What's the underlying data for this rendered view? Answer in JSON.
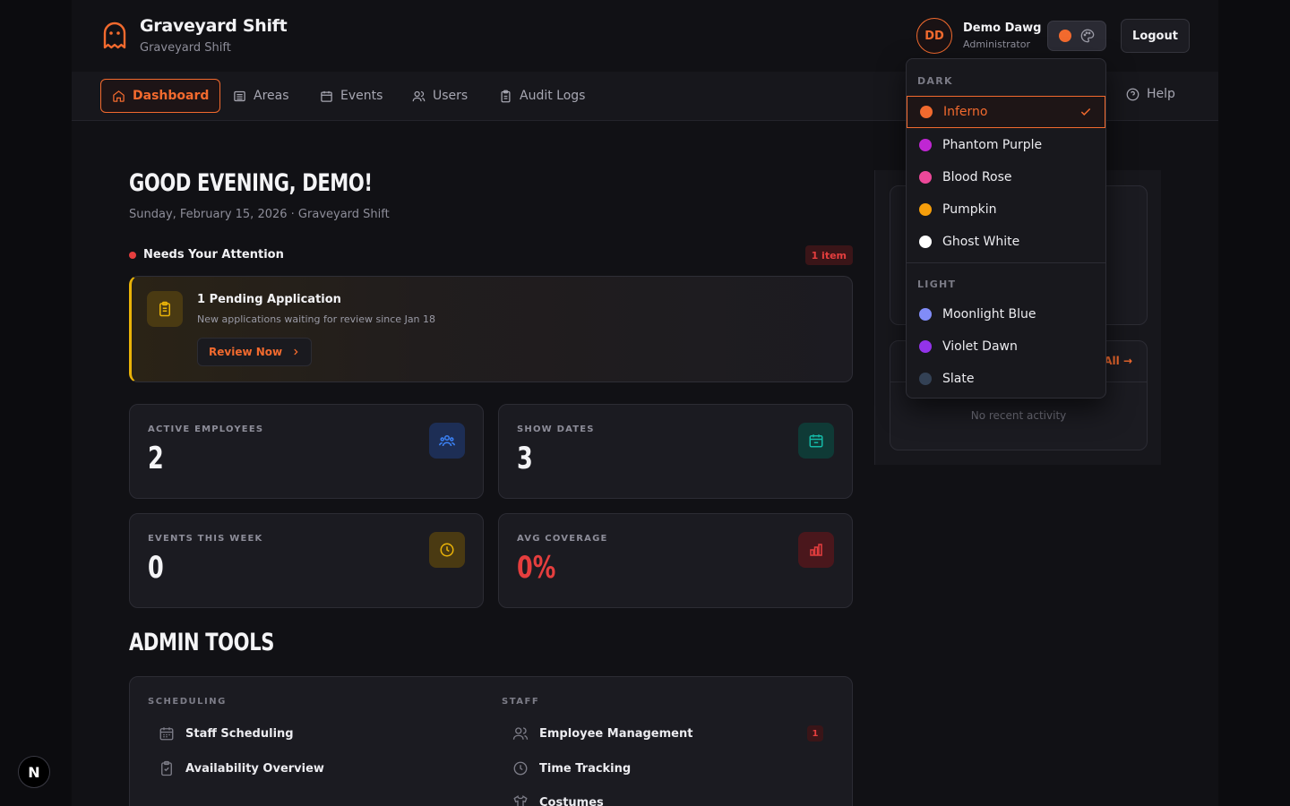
{
  "colors": {
    "accent": "#f26a2e",
    "danger": "#e53e3e",
    "warning": "#eab308"
  },
  "brand": {
    "title": "Graveyard Shift",
    "subtitle": "Graveyard Shift",
    "icon": "ghost-icon"
  },
  "user": {
    "initials": "DD",
    "name": "Demo Dawg",
    "role": "Administrator",
    "logout_label": "Logout"
  },
  "nav": {
    "items": [
      {
        "label": "Dashboard",
        "icon": "home-icon"
      },
      {
        "label": "Areas",
        "icon": "building-icon"
      },
      {
        "label": "Events",
        "icon": "calendar-icon"
      },
      {
        "label": "Users",
        "icon": "users-icon"
      },
      {
        "label": "Audit Logs",
        "icon": "clipboard-icon"
      }
    ],
    "help_label": "Help"
  },
  "greeting": {
    "title": "GOOD EVENING, DEMO!",
    "date_line": "Sunday, February 15, 2026 · Graveyard Shift"
  },
  "attention": {
    "label": "Needs Your Attention",
    "badge": "1 item",
    "card": {
      "title": "1 Pending Application",
      "description": "New applications waiting for review since Jan 18",
      "button": "Review Now"
    }
  },
  "stats": [
    {
      "label": "ACTIVE EMPLOYEES",
      "value": "2",
      "icon": "users-icon",
      "color": "#3b82f6"
    },
    {
      "label": "SHOW DATES",
      "value": "3",
      "icon": "calendar-icon",
      "color": "#14b8a6"
    },
    {
      "label": "EVENTS THIS WEEK",
      "value": "0",
      "icon": "clock-icon",
      "color": "#eab308"
    },
    {
      "label": "AVG COVERAGE",
      "value": "0%",
      "icon": "bar-chart-icon",
      "color": "#e53e3e"
    }
  ],
  "tools": {
    "title": "ADMIN TOOLS",
    "sections": [
      {
        "label": "SCHEDULING",
        "items": [
          "Staff Scheduling",
          "Availability Overview"
        ]
      },
      {
        "label": "STAFF",
        "items": [
          "Employee Management",
          "Time Tracking",
          "Costumes"
        ],
        "badge": "1"
      }
    ]
  },
  "activity": {
    "view_all": "All →",
    "empty": "No recent activity"
  },
  "theme_menu": {
    "dark_label": "DARK",
    "light_label": "LIGHT",
    "dark": [
      {
        "name": "Inferno",
        "color": "#f26a2e",
        "selected": true
      },
      {
        "name": "Phantom Purple",
        "color": "#c026d3"
      },
      {
        "name": "Blood Rose",
        "color": "#ec4899"
      },
      {
        "name": "Pumpkin",
        "color": "#f59e0b"
      },
      {
        "name": "Ghost White",
        "color": "#ffffff"
      }
    ],
    "light": [
      {
        "name": "Moonlight Blue",
        "color": "#818cf8"
      },
      {
        "name": "Violet Dawn",
        "color": "#9333ea"
      },
      {
        "name": "Slate",
        "color": "#334155"
      }
    ]
  }
}
